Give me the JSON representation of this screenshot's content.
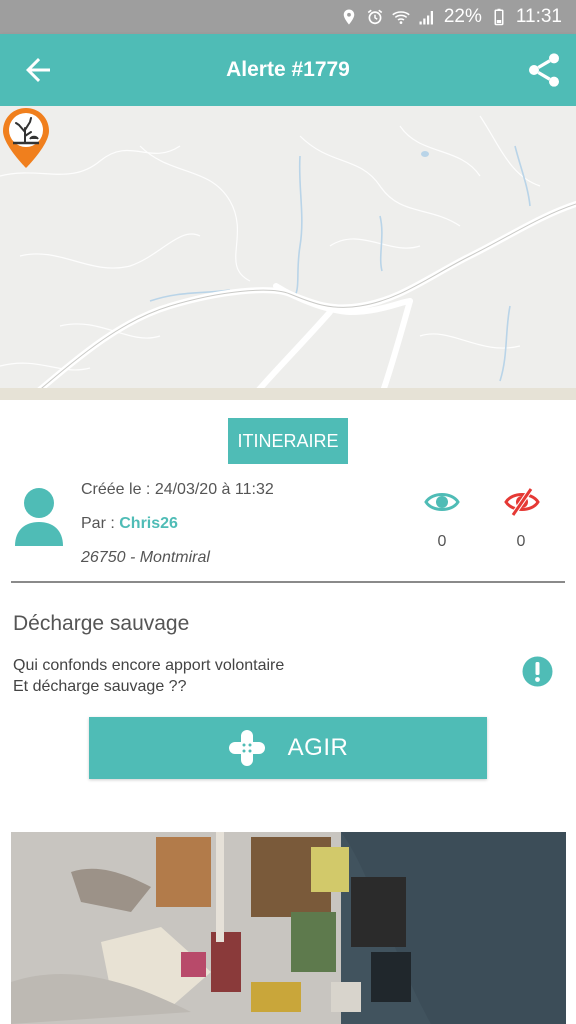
{
  "status_bar": {
    "battery": "22%",
    "time": "11:31",
    "icons": [
      "location-icon",
      "alarm-icon",
      "wifi-icon",
      "signal-icon",
      "battery-icon"
    ]
  },
  "app_bar": {
    "title": "Alerte #1779",
    "back_icon": "arrow-left-icon",
    "share_icon": "share-icon"
  },
  "map": {
    "marker_icon": "dead-tree-pin-icon"
  },
  "itinerary_button": "ITINERAIRE",
  "alert": {
    "created": "Créée le : 24/03/20 à 11:32",
    "by_label": "Par : ",
    "author": "Chris26",
    "location": "26750 - Montmiral",
    "seen_count": "0",
    "unseen_count": "0",
    "category": "Décharge sauvage",
    "description_line1": "Qui confonds encore apport volontaire",
    "description_line2": "Et décharge sauvage ??"
  },
  "action_button": "AGIR",
  "colors": {
    "primary": "#4fbcb6",
    "danger": "#e53935",
    "marker": "#f07f1d"
  }
}
